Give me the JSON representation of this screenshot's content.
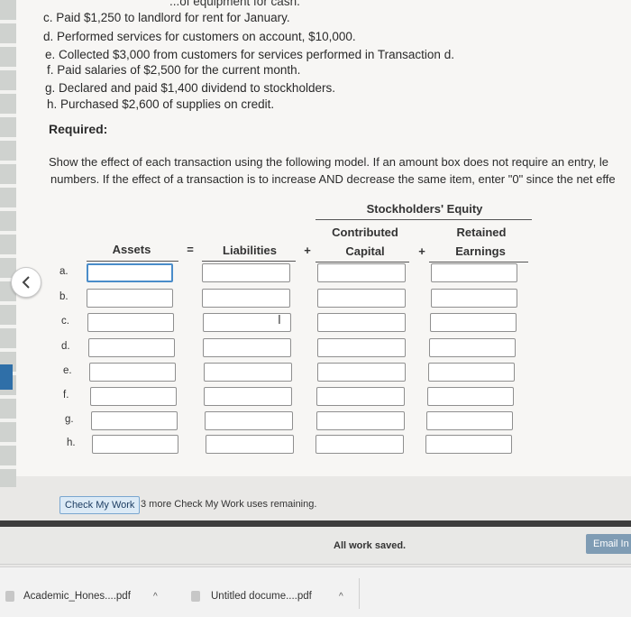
{
  "problem": {
    "top_clipped": "...of equipment for cash.",
    "transactions": [
      "c. Paid $1,250 to landlord for rent for January.",
      "d. Performed services for customers on account, $10,000.",
      "e. Collected $3,000 from customers for services performed in Transaction d.",
      "f. Paid salaries of $2,500 for the current month.",
      "g. Declared and paid $1,400 dividend to stockholders.",
      "h. Purchased $2,600 of supplies on credit."
    ],
    "required_label": "Required:",
    "instruction_line1": "Show the effect of each transaction using the following model. If an amount box does not require an entry, le",
    "instruction_line2": "numbers. If the effect of a transaction is to increase AND decrease the same item, enter \"0\" since the net effe"
  },
  "model": {
    "equity_header": "Stockholders' Equity",
    "col_assets": "Assets",
    "sym_equals": "=",
    "col_liabilities": "Liabilities",
    "sym_plus1": "+",
    "col_cc_line1": "Contributed",
    "col_cc_line2": "Capital",
    "sym_plus2": "+",
    "col_re_line1": "Retained",
    "col_re_line2": "Earnings",
    "rows": [
      {
        "label": "a.",
        "assets": "",
        "liabilities": "",
        "contributed_capital": "",
        "retained_earnings": ""
      },
      {
        "label": "b.",
        "assets": "",
        "liabilities": "",
        "contributed_capital": "",
        "retained_earnings": ""
      },
      {
        "label": "c.",
        "assets": "",
        "liabilities": "",
        "contributed_capital": "",
        "retained_earnings": ""
      },
      {
        "label": "d.",
        "assets": "",
        "liabilities": "",
        "contributed_capital": "",
        "retained_earnings": ""
      },
      {
        "label": "e.",
        "assets": "",
        "liabilities": "",
        "contributed_capital": "",
        "retained_earnings": ""
      },
      {
        "label": "f.",
        "assets": "",
        "liabilities": "",
        "contributed_capital": "",
        "retained_earnings": ""
      },
      {
        "label": "g.",
        "assets": "",
        "liabilities": "",
        "contributed_capital": "",
        "retained_earnings": ""
      },
      {
        "label": "h.",
        "assets": "",
        "liabilities": "",
        "contributed_capital": "",
        "retained_earnings": ""
      }
    ]
  },
  "check": {
    "button_label": "Check My Work",
    "note": "3 more Check My Work uses remaining."
  },
  "footer": {
    "saved": "All work saved.",
    "email": "Email In"
  },
  "downloads": [
    {
      "name": "Academic_Hones....pdf",
      "icon": "pdf-file-icon"
    },
    {
      "name": "Untitled docume....pdf",
      "icon": "pdf-file-icon"
    }
  ],
  "colors": {
    "active_border": "#4a8cc9",
    "email_button": "#7f9cb4",
    "check_button": "#dceaf6"
  }
}
